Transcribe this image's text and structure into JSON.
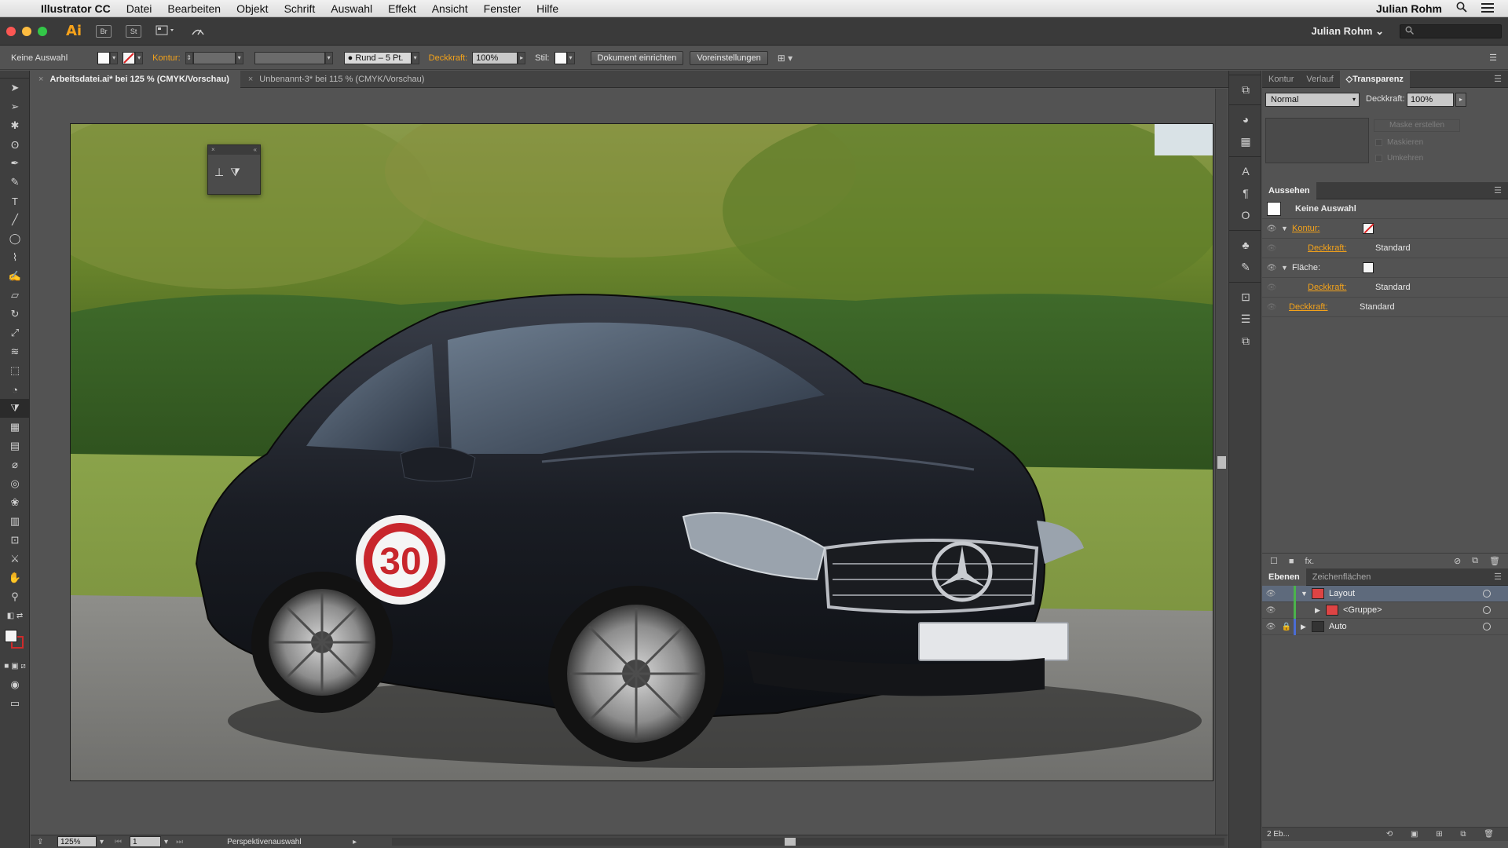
{
  "menubar": {
    "app_name": "Illustrator CC",
    "menus": [
      "Datei",
      "Bearbeiten",
      "Objekt",
      "Schrift",
      "Auswahl",
      "Effekt",
      "Ansicht",
      "Fenster",
      "Hilfe"
    ],
    "user": "Julian Rohm"
  },
  "appbar": {
    "logo": "Ai",
    "bridge_label": "Br",
    "stock_label": "St",
    "workspace_user": "Julian Rohm ⌄"
  },
  "controlbar": {
    "selection": "Keine Auswahl",
    "stroke_label": "Kontur:",
    "brush_label": "● Rund – 5 Pt.",
    "opacity_label": "Deckkraft:",
    "opacity_value": "100%",
    "style_label": "Stil:",
    "doc_setup_button": "Dokument einrichten",
    "prefs_button": "Voreinstellungen"
  },
  "doctabs": [
    {
      "label": "Arbeitsdatei.ai* bei 125 % (CMYK/Vorschau)",
      "active": true
    },
    {
      "label": "Unbenannt-3* bei 115 % (CMYK/Vorschau)",
      "active": false
    }
  ],
  "statusbar": {
    "zoom": "125%",
    "page": "1",
    "tool_status": "Perspektivenauswahl"
  },
  "transparency_panel": {
    "tabs": [
      "Kontur",
      "Verlauf",
      "◇Transparenz"
    ],
    "blend_mode": "Normal",
    "opacity_label": "Deckkraft:",
    "opacity_value": "100%",
    "make_mask_button": "Maske erstellen",
    "clip_label": "Maskieren",
    "invert_label": "Umkehren"
  },
  "appearance_panel": {
    "title": "Aussehen",
    "selection_label": "Keine Auswahl",
    "stroke_label": "Kontur:",
    "fill_label": "Fläche:",
    "opacity_label": "Deckkraft:",
    "opacity_value": "Standard",
    "fx_label": "fx."
  },
  "layers_panel": {
    "tabs": [
      "Ebenen",
      "Zeichenflächen"
    ],
    "layers": [
      {
        "name": "Layout"
      },
      {
        "name": "<Gruppe>"
      },
      {
        "name": "Auto"
      }
    ],
    "footer": "2 Eb..."
  },
  "artwork": {
    "badge_number": "30"
  },
  "colors": {
    "accent_orange": "#f5a31a",
    "selection_blue": "#5e6a7c",
    "badge_red": "#c8262c"
  }
}
